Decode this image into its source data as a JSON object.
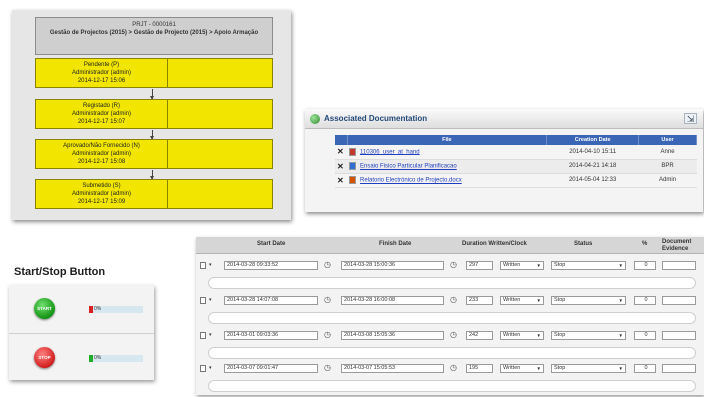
{
  "workflow": {
    "code": "PRJT - 0000161",
    "description": "Gestão de Projectos (2015) > Gestão de Projecto (2015) > Apoio Armação",
    "steps": [
      {
        "status": "Pendente (P)",
        "user": "Administrador (admin)",
        "date": "2014-12-17 15:06"
      },
      {
        "status": "Registado (R)",
        "user": "Administrador (admin)",
        "date": "2014-12-17 15:07"
      },
      {
        "status": "Aprovado/Não Fornecido (N)",
        "user": "Administrador (admin)",
        "date": "2014-12-17 15:08"
      },
      {
        "status": "Submetido (S)",
        "user": "Administrador (admin)",
        "date": "2014-12-17 15:09"
      }
    ]
  },
  "documentation": {
    "title": "Associated Documentation",
    "columns": [
      "File",
      "Creation Date",
      "User"
    ],
    "rows": [
      {
        "file": "110306_user_at_hand",
        "date": "2014-04-10 15:11",
        "user": "Anne",
        "icon_color": "#c0392b"
      },
      {
        "file": "Ensaio Fisico Particular Planificacao",
        "date": "2014-04-21 14:18",
        "user": "BPR",
        "icon_color": "#2e6fd1"
      },
      {
        "file": "Relatorio Electrónico de Projecto.docx",
        "date": "2014-05-04 12:33",
        "user": "Admin",
        "icon_color": "#d35400"
      }
    ]
  },
  "startstop": {
    "label": "Start/Stop Button",
    "rows": [
      {
        "button": "START",
        "pct": "0%",
        "marker_color": "#d92020"
      },
      {
        "button": "STOP",
        "pct": "0%",
        "marker_color": "#1fae27"
      }
    ]
  },
  "timetable": {
    "headers": {
      "start": "Start Date",
      "finish": "Finish Date",
      "duration": "Duration Written/Clock",
      "status": "Status",
      "percent": "%",
      "doc": "Document Evidence"
    },
    "rows": [
      {
        "start": "2014-03-28 09:33:52",
        "finish": "2014-03-28 15:00:36",
        "duration": "297",
        "unit": "Written",
        "status": "Stop",
        "percent": "0"
      },
      {
        "start": "2014-03-28 14:07:08",
        "finish": "2014-03-28 16:00:08",
        "duration": "233",
        "unit": "Written",
        "status": "Stop",
        "percent": "0"
      },
      {
        "start": "2014-03-01 09:03:36",
        "finish": "2014-03-08 15:05:36",
        "duration": "242",
        "unit": "Written",
        "status": "Stop",
        "percent": "0"
      },
      {
        "start": "2014-03-07 09:01:47",
        "finish": "2014-03-07 15:05:53",
        "duration": "195",
        "unit": "Written",
        "status": "Stop",
        "percent": "0"
      }
    ]
  }
}
